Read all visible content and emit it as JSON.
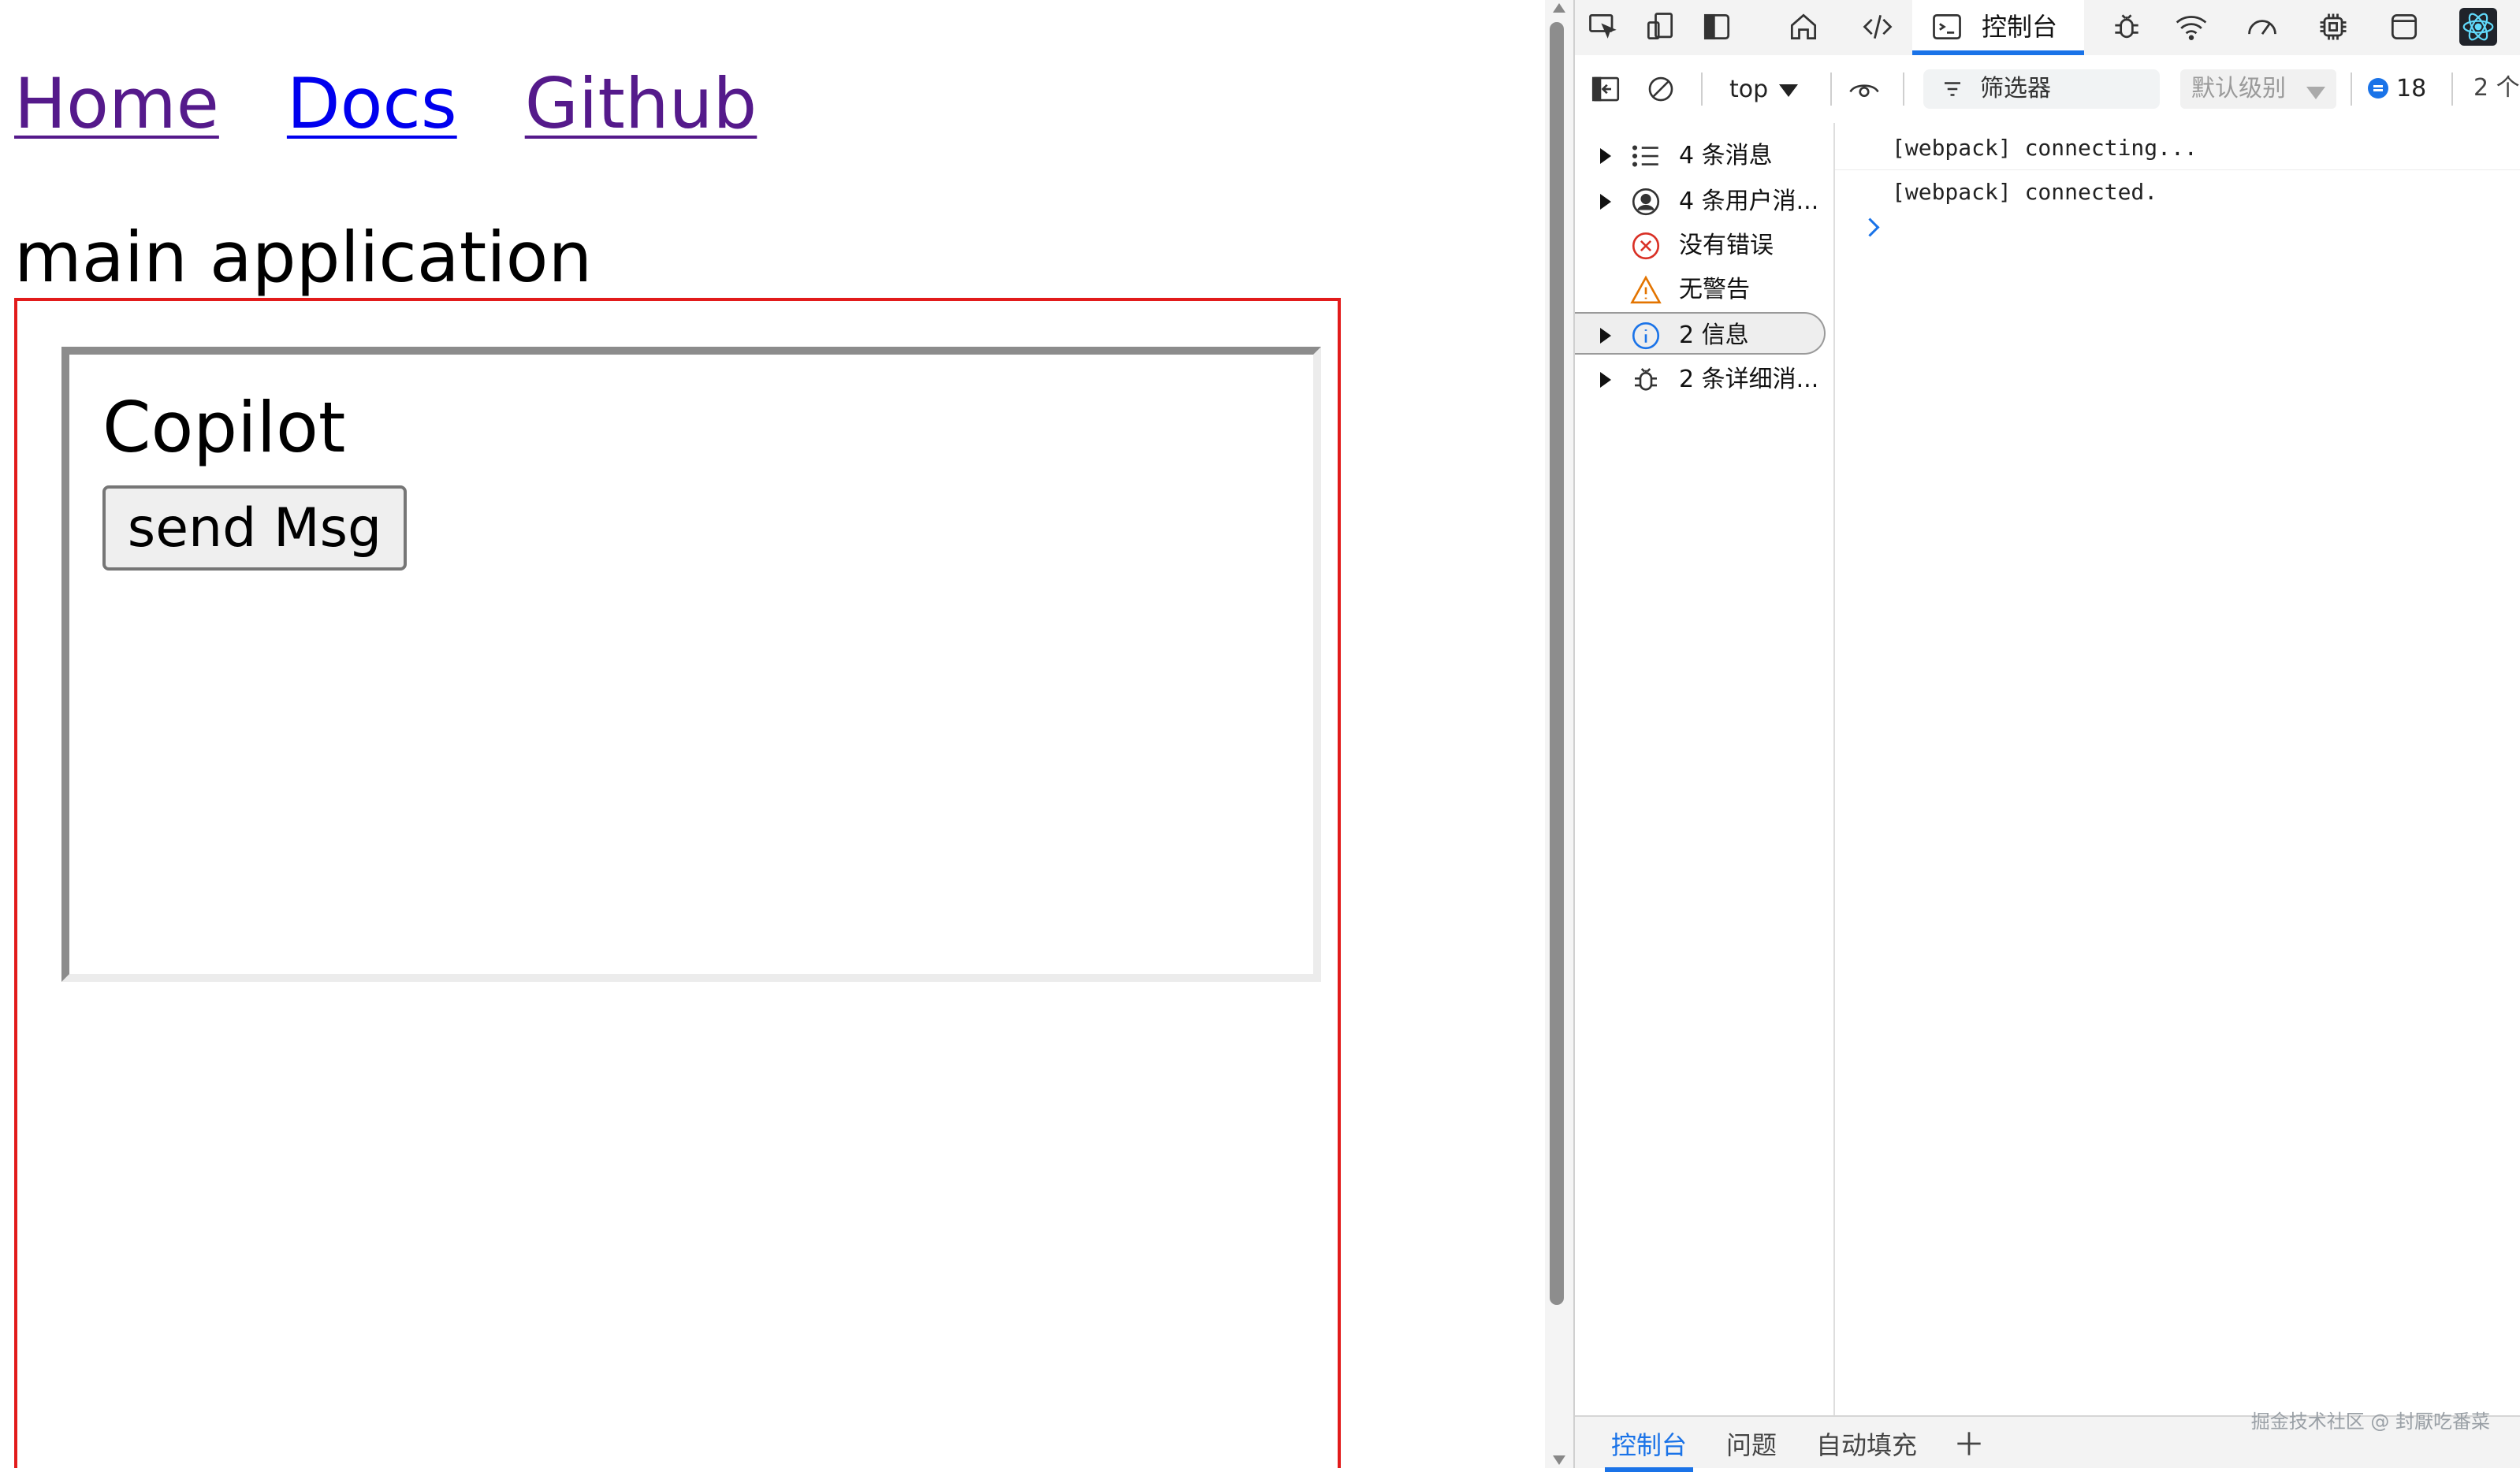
{
  "page": {
    "nav": [
      {
        "label": "Home",
        "state": "visited"
      },
      {
        "label": "Docs",
        "state": "link"
      },
      {
        "label": "Github",
        "state": "visited"
      }
    ],
    "app_title": "main application",
    "copilot": {
      "title": "Copilot",
      "send_button_label": "send Msg"
    }
  },
  "devtools": {
    "toolbar": {
      "icons": [
        "inspect-element-icon",
        "device-emulation-icon",
        "dock-side-icon",
        "welcome-home-icon",
        "elements-code-icon",
        "network-wifi-icon",
        "performance-gauge-icon",
        "memory-chip-icon",
        "application-window-icon",
        "react-devtools-icon"
      ],
      "console_tab_label": "控制台"
    },
    "filterbar": {
      "context_value": "top",
      "filter_placeholder": "筛选器",
      "level_value": "默认级别",
      "message_count": "18",
      "issues_text": "2 个"
    },
    "sidebar": {
      "items": [
        {
          "label": "4 条消息",
          "icon": "list-icon",
          "expandable": true
        },
        {
          "label": "4 条用户消...",
          "icon": "user-icon",
          "expandable": true
        },
        {
          "label": "没有错误",
          "icon": "error-icon",
          "expandable": false
        },
        {
          "label": "无警告",
          "icon": "warning-icon",
          "expandable": false
        },
        {
          "label": "2 信息",
          "icon": "info-icon",
          "expandable": true,
          "selected": true
        },
        {
          "label": "2 条详细消...",
          "icon": "bug-icon",
          "expandable": true
        }
      ]
    },
    "console": {
      "logs": [
        "[webpack] connecting...",
        "[webpack] connected."
      ]
    },
    "drawer": {
      "tabs": [
        "控制台",
        "问题",
        "自动填充"
      ],
      "active_tab": "控制台"
    },
    "watermark": "掘金技术社区 @ 封厭吃番菜"
  },
  "colors": {
    "main_border": "#e21b1b",
    "accent": "#1a73e8",
    "visited_link": "#551a8b",
    "link": "#0000ee"
  }
}
